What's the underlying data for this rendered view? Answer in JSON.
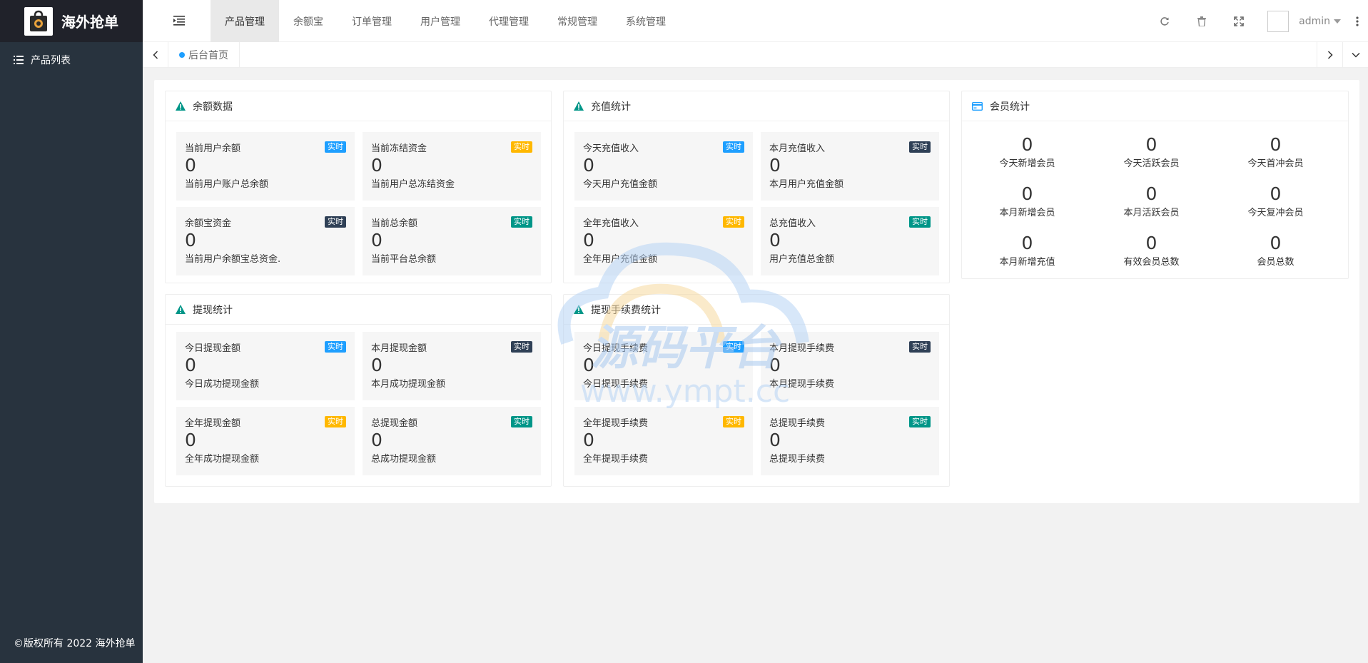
{
  "brand": {
    "name": "海外抢单"
  },
  "sidebar": {
    "items": [
      {
        "label": "产品列表"
      }
    ],
    "copyright": "©版权所有 2022 海外抢单"
  },
  "header": {
    "nav": [
      {
        "label": "产品管理",
        "active": true
      },
      {
        "label": "余额宝"
      },
      {
        "label": "订单管理"
      },
      {
        "label": "用户管理"
      },
      {
        "label": "代理管理"
      },
      {
        "label": "常规管理"
      },
      {
        "label": "系统管理"
      }
    ],
    "user": "admin"
  },
  "tabs": {
    "home": "后台首页"
  },
  "colors": {
    "blue": "#1e9fff",
    "yellow": "#ffb800",
    "dark": "#2f4056",
    "green": "#009688"
  },
  "cards": {
    "balance": {
      "title": "余额数据",
      "items": [
        {
          "label": "当前用户余额",
          "value": "0",
          "desc": "当前用户账户总余额",
          "badge": "实时"
        },
        {
          "label": "当前冻结资金",
          "value": "0",
          "desc": "当前用户总冻结资金",
          "badge": "实时"
        },
        {
          "label": "余额宝资金",
          "value": "0",
          "desc": "当前用户余额宝总资金.",
          "badge": "实时"
        },
        {
          "label": "当前总余额",
          "value": "0",
          "desc": "当前平台总余额",
          "badge": "实时"
        }
      ]
    },
    "recharge": {
      "title": "充值统计",
      "items": [
        {
          "label": "今天充值收入",
          "value": "0",
          "desc": "今天用户充值金额",
          "badge": "实时"
        },
        {
          "label": "本月充值收入",
          "value": "0",
          "desc": "本月用户充值金额",
          "badge": "实时"
        },
        {
          "label": "全年充值收入",
          "value": "0",
          "desc": "全年用户充值金额",
          "badge": "实时"
        },
        {
          "label": "总充值收入",
          "value": "0",
          "desc": "用户充值总金额",
          "badge": "实时"
        }
      ]
    },
    "member": {
      "title": "会员统计",
      "items": [
        {
          "value": "0",
          "label": "今天新增会员"
        },
        {
          "value": "0",
          "label": "今天活跃会员"
        },
        {
          "value": "0",
          "label": "今天首冲会员"
        },
        {
          "value": "0",
          "label": "本月新增会员"
        },
        {
          "value": "0",
          "label": "本月活跃会员"
        },
        {
          "value": "0",
          "label": "今天复冲会员"
        },
        {
          "value": "0",
          "label": "本月新增充值"
        },
        {
          "value": "0",
          "label": "有效会员总数"
        },
        {
          "value": "0",
          "label": "会员总数"
        }
      ]
    },
    "withdraw": {
      "title": "提现统计",
      "items": [
        {
          "label": "今日提现金额",
          "value": "0",
          "desc": "今日成功提现金额",
          "badge": "实时"
        },
        {
          "label": "本月提现金额",
          "value": "0",
          "desc": "本月成功提现金额",
          "badge": "实时"
        },
        {
          "label": "全年提现金额",
          "value": "0",
          "desc": "全年成功提现金额",
          "badge": "实时"
        },
        {
          "label": "总提现金额",
          "value": "0",
          "desc": "总成功提现金额",
          "badge": "实时"
        }
      ]
    },
    "fee": {
      "title": "提现手续费统计",
      "items": [
        {
          "label": "今日提现手续费",
          "value": "0",
          "desc": "今日提现手续费",
          "badge": "实时"
        },
        {
          "label": "本月提现手续费",
          "value": "0",
          "desc": "本月提现手续费",
          "badge": "实时"
        },
        {
          "label": "全年提现手续费",
          "value": "0",
          "desc": "全年提现手续费",
          "badge": "实时"
        },
        {
          "label": "总提现手续费",
          "value": "0",
          "desc": "总提现手续费",
          "badge": "实时"
        }
      ]
    }
  },
  "watermark": {
    "title": "源码平台",
    "url": "www.ympt.cc"
  }
}
